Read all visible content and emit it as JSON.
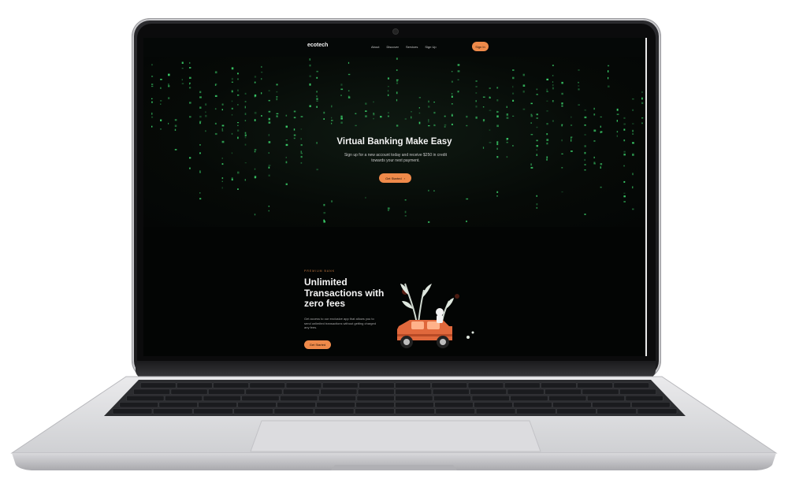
{
  "navbar": {
    "logo": "ecotech",
    "links": [
      "About",
      "Discover",
      "Services",
      "Sign Up"
    ],
    "signin_label": "Sign In"
  },
  "hero": {
    "title": "Virtual Banking Make Easy",
    "subtitle": "Sign up for a new account today and receive $250 in credit towards your next payment.",
    "cta_label": "Get Started",
    "cta_arrow": "›"
  },
  "feature": {
    "eyebrow": "PREMIUM BANK",
    "title": "Unlimited Transactions with zero fees",
    "description": "Get access to our exclusive app that allows you to send unlimited transactions without getting charged any fees.",
    "cta_label": "Get Started"
  },
  "colors": {
    "accent": "#ef8a4a",
    "matrix_green": "#3bd16a",
    "background": "#050807"
  },
  "icons": {
    "hero_background": "digital-matrix-rain",
    "feature_illustration": "orange-jeep-with-plants"
  }
}
